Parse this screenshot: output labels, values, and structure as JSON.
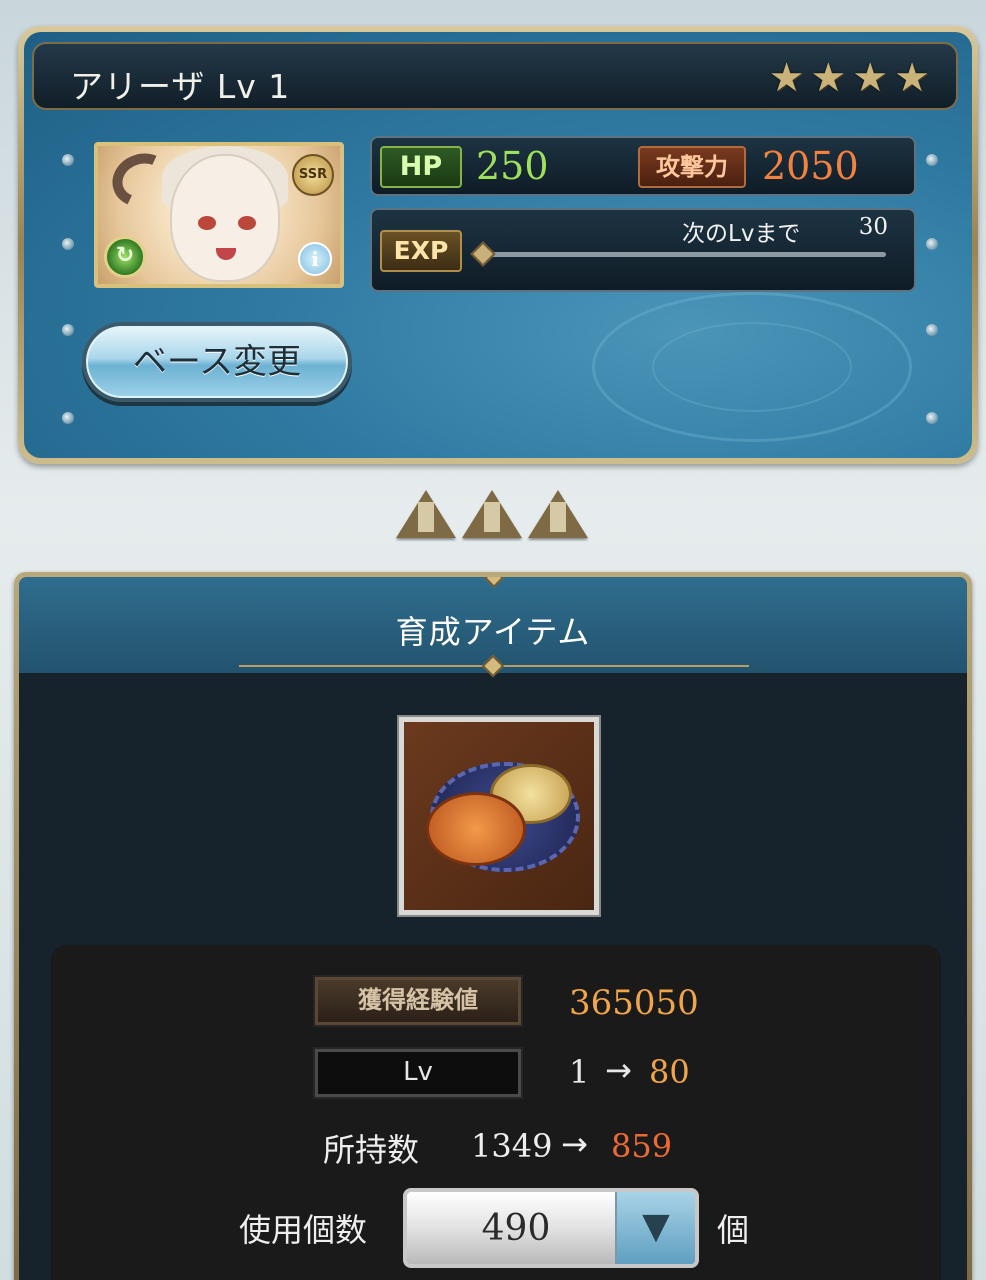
{
  "character": {
    "name_level": "アリーザ Lv 1",
    "stars": [
      "★",
      "★",
      "★",
      "★"
    ],
    "rarity_badge": "SSR",
    "element_icon": "wind-element-icon",
    "info_icon_glyph": "i",
    "hp_label": "HP",
    "hp_value": "250",
    "atk_label": "攻撃力",
    "atk_value": "2050",
    "exp_label": "EXP",
    "next_level_label": "次のLvまで",
    "next_level_value": "30",
    "exp_progress": 0.0,
    "base_change_button": "ベース変更"
  },
  "page_indicator": {
    "count": 3,
    "icon": "pyramid-icon"
  },
  "item_panel": {
    "title": "育成アイテム",
    "item_icon": "halloween-biscuit-item-icon",
    "exp_gain_label": "獲得経験値",
    "exp_gain_value": "365050",
    "lv_label": "Lv",
    "lv_from": "1",
    "lv_arrow": "→",
    "lv_to": "80",
    "owned_label": "所持数",
    "owned_from": "1349",
    "owned_arrow": "→",
    "owned_to": "859",
    "use_count_label": "使用個数",
    "use_count_value": "490",
    "use_count_unit": "個",
    "dropdown_glyph": "▼"
  },
  "colors": {
    "panel_blue": "#2f7aa2",
    "gold_frame": "#b9a87a",
    "hp_green": "#9fe05a",
    "atk_orange": "#f4813e",
    "value_orange": "#f0a548",
    "decrease_red": "#ef6a32"
  }
}
